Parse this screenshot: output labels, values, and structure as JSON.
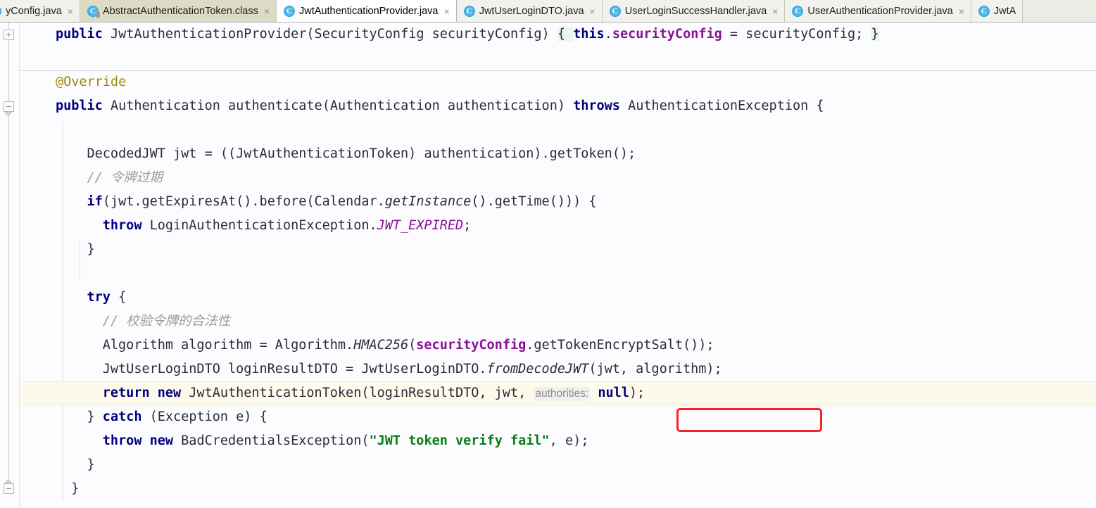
{
  "tabs": [
    {
      "label": "yConfig.java",
      "icon": "java-class-icon",
      "kind": "java",
      "active": false,
      "close": "×"
    },
    {
      "label": "AbstractAuthenticationToken.class",
      "icon": "java-class-locked-icon",
      "kind": "class",
      "active": false,
      "close": "×"
    },
    {
      "label": "JwtAuthenticationProvider.java",
      "icon": "java-class-icon",
      "kind": "java",
      "active": true,
      "close": "×"
    },
    {
      "label": "JwtUserLoginDTO.java",
      "icon": "java-class-icon",
      "kind": "java",
      "active": false,
      "close": "×"
    },
    {
      "label": "UserLoginSuccessHandler.java",
      "icon": "java-class-icon",
      "kind": "java",
      "active": false,
      "close": "×"
    },
    {
      "label": "UserAuthenticationProvider.java",
      "icon": "java-class-icon",
      "kind": "java",
      "active": false,
      "close": "×"
    },
    {
      "label": "JwtA",
      "icon": "java-class-icon",
      "kind": "java",
      "active": false,
      "close": ""
    }
  ],
  "editor": {
    "file": "JwtAuthenticationProvider.java",
    "language": "java",
    "class_icon_letter": "C",
    "inlay_hint": "authorities:",
    "current_line_number": 15,
    "colors": {
      "background": "#fcfcff",
      "keyword": "#00007d",
      "field": "#871094",
      "comment": "#9b9b9b",
      "string": "#067d17",
      "annotation": "#9e880d",
      "current_line": "#fdfaec",
      "folded_region": "#eaf6ea",
      "highlight_box": "#f5232a",
      "inlay_hint_bg": "#f0f0f0"
    },
    "gutter": {
      "fold_collapsed": "+",
      "fold_expanded": "−"
    },
    "lines": [
      {
        "id": "line-constructor",
        "tokens": [
          {
            "t": "public",
            "c": "kw"
          },
          {
            "t": " JwtAuthenticationProvider(SecurityConfig securityConfig) ",
            "c": "ident"
          },
          {
            "t": "{ ",
            "c": "fold"
          },
          {
            "t": "this",
            "c": "kw"
          },
          {
            "t": ".",
            "c": "ident"
          },
          {
            "t": "securityConfig",
            "c": "fld"
          },
          {
            "t": " = securityConfig; ",
            "c": "ident"
          },
          {
            "t": "}",
            "c": "fold"
          }
        ]
      },
      {
        "id": "line-blank-1",
        "tokens": []
      },
      {
        "id": "line-override",
        "tokens": [
          {
            "t": "@Override",
            "c": "ann"
          }
        ]
      },
      {
        "id": "line-method-sig",
        "tokens": [
          {
            "t": "public",
            "c": "kw"
          },
          {
            "t": " Authentication authenticate(Authentication authentication) ",
            "c": "ident"
          },
          {
            "t": "throws",
            "c": "kw"
          },
          {
            "t": " AuthenticationException {",
            "c": "ident"
          }
        ]
      },
      {
        "id": "line-blank-2",
        "tokens": []
      },
      {
        "id": "line-decoded-jwt",
        "indent": 2,
        "tokens": [
          {
            "t": "DecodedJWT jwt = ((JwtAuthenticationToken) authentication).getToken();",
            "c": "ident"
          }
        ]
      },
      {
        "id": "line-comment-expired",
        "indent": 2,
        "tokens": [
          {
            "t": "// 令牌过期",
            "c": "cmt"
          }
        ]
      },
      {
        "id": "line-if-expired",
        "indent": 2,
        "tokens": [
          {
            "t": "if",
            "c": "kw"
          },
          {
            "t": "(jwt.getExpiresAt().before(Calendar.",
            "c": "ident"
          },
          {
            "t": "getInstance",
            "c": "mitl"
          },
          {
            "t": "().getTime())) {",
            "c": "ident"
          }
        ]
      },
      {
        "id": "line-throw-expired",
        "indent": 3,
        "tokens": [
          {
            "t": "throw",
            "c": "kw"
          },
          {
            "t": " LoginAuthenticationException.",
            "c": "ident"
          },
          {
            "t": "JWT_EXPIRED",
            "c": "stat"
          },
          {
            "t": ";",
            "c": "ident"
          }
        ]
      },
      {
        "id": "line-close-if",
        "indent": 2,
        "tokens": [
          {
            "t": "}",
            "c": "ident"
          }
        ]
      },
      {
        "id": "line-blank-3",
        "tokens": []
      },
      {
        "id": "line-try",
        "indent": 2,
        "tokens": [
          {
            "t": "try",
            "c": "kw"
          },
          {
            "t": " {",
            "c": "ident"
          }
        ]
      },
      {
        "id": "line-comment-verify",
        "indent": 3,
        "tokens": [
          {
            "t": "// 校验令牌的合法性",
            "c": "cmt"
          }
        ]
      },
      {
        "id": "line-algorithm",
        "indent": 3,
        "tokens": [
          {
            "t": "Algorithm algorithm = Algorithm.",
            "c": "ident"
          },
          {
            "t": "HMAC256",
            "c": "mitl"
          },
          {
            "t": "(",
            "c": "ident"
          },
          {
            "t": "securityConfig",
            "c": "fld"
          },
          {
            "t": ".getTokenEncryptSalt());",
            "c": "ident"
          }
        ]
      },
      {
        "id": "line-login-result",
        "indent": 3,
        "tokens": [
          {
            "t": "JwtUserLoginDTO loginResultDTO = JwtUserLoginDTO.",
            "c": "ident"
          },
          {
            "t": "fromDecodeJWT",
            "c": "mitl"
          },
          {
            "t": "(jwt, algorithm);",
            "c": "ident"
          }
        ]
      },
      {
        "id": "line-return-token",
        "indent": 3,
        "current": true,
        "tokens": [
          {
            "t": "return",
            "c": "kw"
          },
          {
            "t": " ",
            "c": "ident"
          },
          {
            "t": "new",
            "c": "kw"
          },
          {
            "t": " JwtAuthenticationToken(loginResultDTO, jwt, ",
            "c": "ident"
          },
          {
            "t": "authorities:",
            "c": "hint"
          },
          {
            "t": " ",
            "c": "ident"
          },
          {
            "t": "null",
            "c": "kw"
          },
          {
            "t": ");",
            "c": "ident"
          }
        ]
      },
      {
        "id": "line-catch",
        "indent": 2,
        "tokens": [
          {
            "t": "} ",
            "c": "ident"
          },
          {
            "t": "catch",
            "c": "kw"
          },
          {
            "t": " (Exception e) {",
            "c": "ident"
          }
        ]
      },
      {
        "id": "line-throw-bad",
        "indent": 3,
        "tokens": [
          {
            "t": "throw",
            "c": "kw"
          },
          {
            "t": " ",
            "c": "ident"
          },
          {
            "t": "new",
            "c": "kw"
          },
          {
            "t": " BadCredentialsException(",
            "c": "ident"
          },
          {
            "t": "\"JWT token verify fail\"",
            "c": "str"
          },
          {
            "t": ", e);",
            "c": "ident"
          }
        ]
      },
      {
        "id": "line-close-try",
        "indent": 2,
        "tokens": [
          {
            "t": "}",
            "c": "ident"
          }
        ]
      },
      {
        "id": "line-close-method",
        "indent": 1,
        "tokens": [
          {
            "t": "}",
            "c": "ident"
          }
        ]
      }
    ]
  }
}
